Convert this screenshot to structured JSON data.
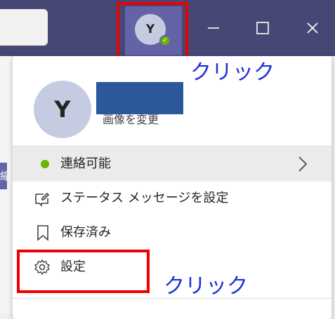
{
  "profile": {
    "avatar_initial": "Y",
    "change_photo": "画像を変更",
    "presence_color": "#6bb700"
  },
  "menu": {
    "status": "連絡可能",
    "status_message": "ステータス メッセージを設定",
    "saved": "保存済み",
    "settings": "設定"
  },
  "annotations": {
    "click_top": "クリック",
    "click_settings": "クリック"
  },
  "titlebar": {
    "window_controls": [
      "minimize-icon",
      "maximize-icon",
      "close-icon"
    ],
    "left_partial_text": "縮ク"
  },
  "colors": {
    "titlebar": "#464775",
    "accent": "#6264a7",
    "highlight_box": "#ee0000",
    "annotation_text": "#1f2fd9"
  }
}
